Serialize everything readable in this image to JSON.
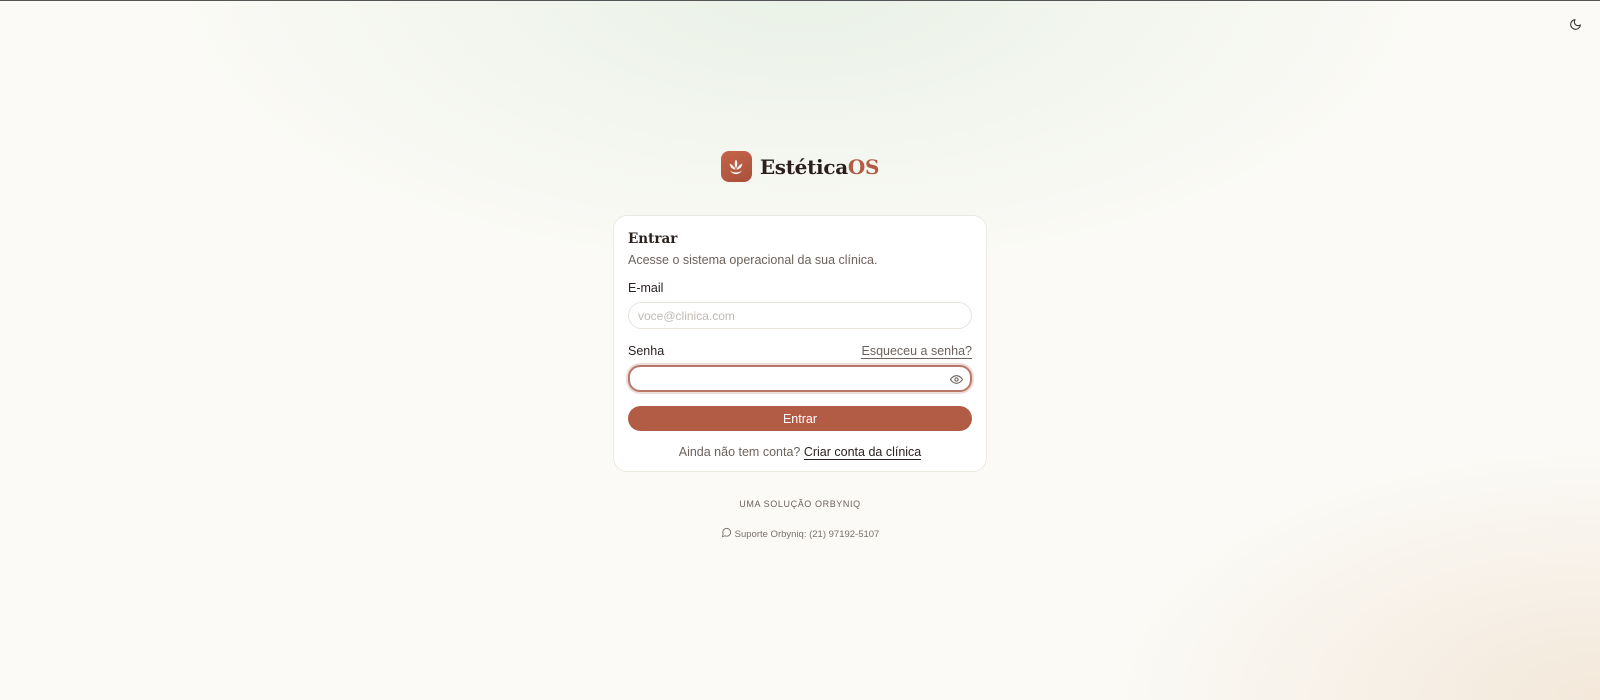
{
  "brand": {
    "name_main": "Estética",
    "name_accent": "OS",
    "logo_icon": "lotus-icon"
  },
  "header": {
    "theme_toggle_icon": "moon-icon"
  },
  "login_card": {
    "title": "Entrar",
    "subtitle": "Acesse o sistema operacional da sua clínica.",
    "email": {
      "label": "E-mail",
      "placeholder": "voce@clinica.com",
      "value": ""
    },
    "password": {
      "label": "Senha",
      "value": "",
      "forgot_link": "Esqueceu a senha?",
      "visibility_icon": "eye-icon"
    },
    "submit_label": "Entrar",
    "signup_prompt": "Ainda não tem conta?",
    "signup_link": "Criar conta da clínica"
  },
  "footer": {
    "tagline": "UMA SOLUÇÃO ORBYNIQ",
    "support_icon": "chat-bubble-icon",
    "support_text": "Suporte Orbyniq: (21) 97192-5107"
  },
  "colors": {
    "accent": "#b35c45",
    "focus_ring": "#b9776a",
    "background": "#fbfaf6"
  }
}
